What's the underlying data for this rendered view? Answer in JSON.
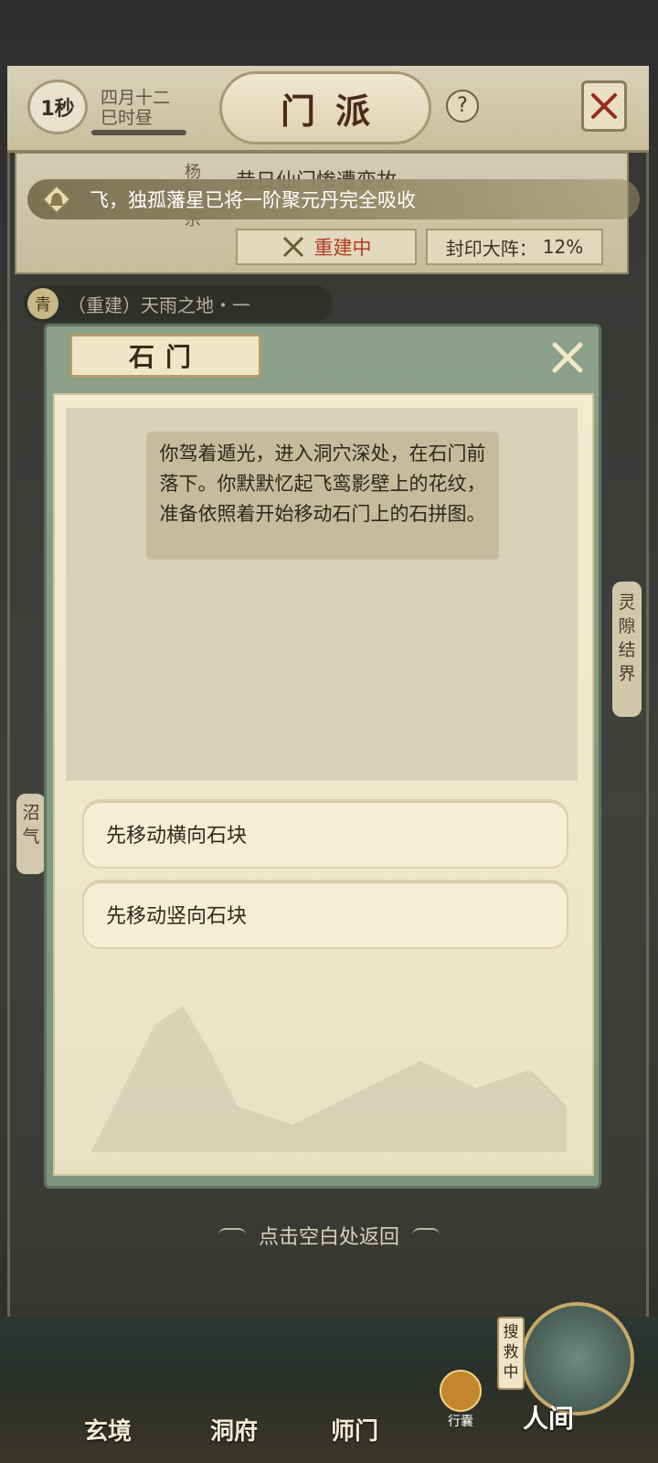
{
  "header": {
    "timer": "1秒",
    "date_line1": "四月十二",
    "date_line2": "巳时昼",
    "title": "门派",
    "help_label": "?"
  },
  "sect": {
    "name": "杨仙宗",
    "description": "昔日仙门惨遭变故",
    "status": "重建中",
    "seal_label": "封印大阵：",
    "seal_value": "12%"
  },
  "notice": {
    "text": "飞，独孤藩星已将一阶聚元丹完全吸收"
  },
  "area": {
    "icon_char": "青",
    "label": "（重建）天雨之地・一"
  },
  "side_labels": {
    "right": "灵隙结界",
    "left": "沼气"
  },
  "dialog": {
    "title": "石门",
    "story": "你驾着遁光，进入洞穴深处，在石门前落下。你默默忆起飞鸾影壁上的花纹，准备依照着开始移动石门上的石拼图。",
    "options": [
      {
        "label": "先移动横向石块"
      },
      {
        "label": "先移动竖向石块"
      }
    ]
  },
  "return_hint": "点击空白处返回",
  "bottom_nav": {
    "items": [
      {
        "label": "玄境"
      },
      {
        "label": "洞府"
      },
      {
        "label": "师门"
      }
    ],
    "bag_label": "行囊",
    "world_label": "人间",
    "search_tag": "搜救中"
  },
  "colors": {
    "status_red": "#b23a22",
    "dialog_green": "#8aa08a",
    "paper": "#f2ebd0"
  }
}
